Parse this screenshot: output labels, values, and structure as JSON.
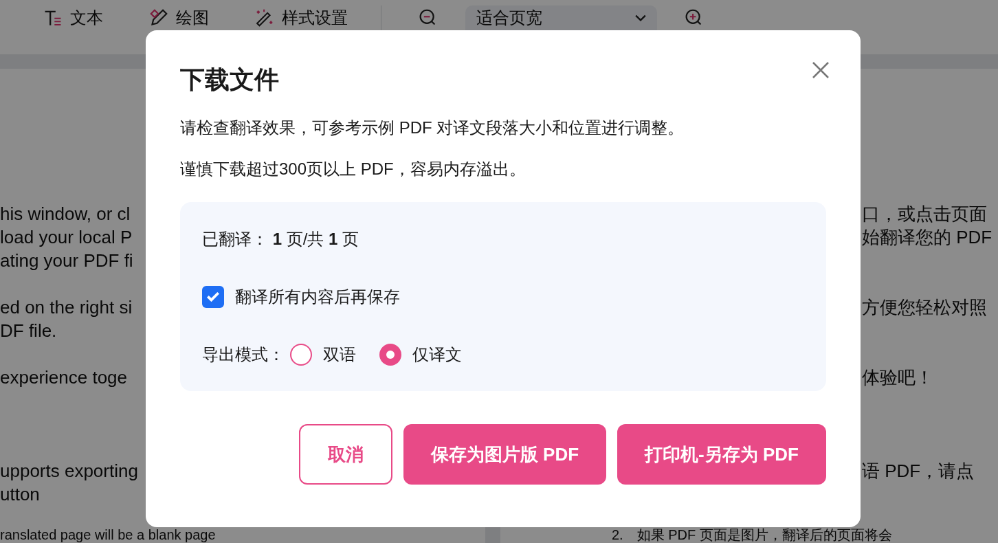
{
  "toolbar": {
    "tools": [
      {
        "label": "文本",
        "kind": "text"
      },
      {
        "label": "绘图",
        "kind": "draw"
      },
      {
        "label": "样式设置",
        "kind": "style"
      }
    ],
    "zoom": {
      "value": "适合页宽"
    }
  },
  "document": {
    "left_paragraphs": [
      {
        "kind": "text",
        "lines": [
          "his window, or cl",
          "load your local P",
          "ating your PDF fi"
        ]
      },
      {
        "kind": "text",
        "lines": [
          "ed on the right si",
          "DF file."
        ]
      },
      {
        "kind": "text",
        "lines": [
          "experience toge"
        ]
      },
      {
        "kind": "text",
        "lines": [
          "upports exporting",
          "utton"
        ]
      },
      {
        "kind": "text",
        "lines": [
          "ranslated page will be a blank page"
        ]
      }
    ],
    "right_paragraphs": [
      {
        "kind": "text",
        "lines": [
          "口，或点击页面",
          "始翻译您的 PDF"
        ]
      },
      {
        "kind": "text",
        "lines": [
          "方便您轻松对照"
        ]
      },
      {
        "kind": "text",
        "lines": [
          "体验吧！"
        ]
      },
      {
        "kind": "text",
        "lines": [
          "语 PDF，请点"
        ]
      },
      {
        "kind": "list_item",
        "number": "2.",
        "lines": [
          "如果 PDF 页面是图片，翻译后的页面将会"
        ]
      }
    ]
  },
  "dialog": {
    "title": "下载文件",
    "messages": [
      "请检查翻译效果，可参考示例 PDF 对译文段落大小和位置进行调整。",
      "谨慎下载超过300页以上 PDF，容易内存溢出。"
    ],
    "progress": "已翻译：  **1** 页/共 **1** 页",
    "option": {
      "label": "翻译所有内容后再保存",
      "checked": true
    },
    "export_mode": {
      "label": "导出模式：",
      "options": [
        {
          "label": "双语",
          "selected": false
        },
        {
          "label": "仅译文",
          "selected": true
        }
      ]
    },
    "buttons": [
      {
        "label": "取消",
        "kind": "secondary"
      },
      {
        "label": "保存为图片版 PDF",
        "kind": "primary"
      },
      {
        "label": "打印机-另存为 PDF",
        "kind": "primary"
      }
    ]
  }
}
